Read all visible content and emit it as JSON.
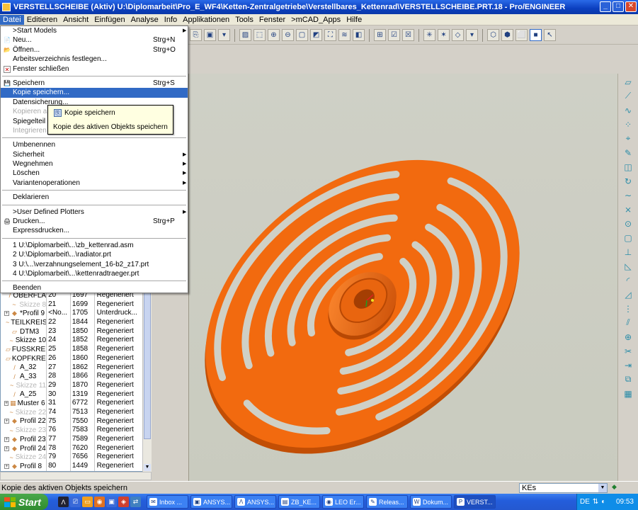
{
  "window": {
    "title": "VERSTELLSCHEIBE (Aktiv) U:\\Diplomarbeit\\Pro_E_WF4\\Ketten-Zentralgetriebe\\Verstellbares_Kettenrad\\VERSTELLSCHEIBE.PRT.18 - Pro/ENGINEER",
    "buttons": {
      "minimize": "_",
      "maximize": "□",
      "close": "✕"
    }
  },
  "menubar": [
    "Datei",
    "Editieren",
    "Ansicht",
    "Einfügen",
    "Analyse",
    "Info",
    "Applikationen",
    "Tools",
    "Fenster",
    ">mCAD_Apps",
    "Hilfe"
  ],
  "file_menu": {
    "start_models": ">Start Models",
    "neu": "Neu...",
    "neu_sc": "Strg+N",
    "oeffnen": "Öffnen...",
    "oeffnen_sc": "Strg+O",
    "arbeitsverzeichnis": "Arbeitsverzeichnis festlegen...",
    "fenster_schliessen": "Fenster schließen",
    "speichern": "Speichern",
    "speichern_sc": "Strg+S",
    "kopie_speichern": "Kopie speichern...",
    "datensicherung": "Datensicherung...",
    "kopieren_als": "Kopieren a",
    "spiegelteil": "Spiegelteil",
    "integrieren": "Integrieren",
    "umbenennen": "Umbenennen",
    "sicherheit": "Sicherheit",
    "wegnehmen": "Wegnehmen",
    "loeschen": "Löschen",
    "variantenoperationen": "Variantenoperationen",
    "deklarieren": "Deklarieren",
    "user_plotters": ">User Defined Plotters",
    "drucken": "Drucken...",
    "drucken_sc": "Strg+P",
    "expressdrucken": "Expressdrucken...",
    "recent1": "1 U:\\Diplomarbeit\\...\\zb_kettenrad.asm",
    "recent2": "2 U:\\Diplomarbeit\\...\\radiator.prt",
    "recent3": "3 U:\\...\\verzahnungselement_16-b2_z17.prt",
    "recent4": "4 U:\\Diplomarbeit\\...\\kettenradtraeger.prt",
    "beenden": "Beenden"
  },
  "tooltip": {
    "title": "Kopie speichern",
    "description": "Kopie des aktiven Objekts speichern"
  },
  "tree_rows": [
    {
      "name": "OBERFLÄ",
      "num": "20",
      "id": "1697",
      "status": "Regeneriert",
      "icon": "/",
      "expand": false,
      "dim": false
    },
    {
      "name": "Skizze 8",
      "num": "21",
      "id": "1699",
      "status": "Regeneriert",
      "icon": "~",
      "expand": false,
      "dim": true
    },
    {
      "name": "*Profil 9",
      "num": "<No...",
      "id": "1705",
      "status": "Unterdruck...",
      "icon": "◆",
      "expand": true,
      "dim": false
    },
    {
      "name": "TEILKREIS",
      "num": "22",
      "id": "1844",
      "status": "Regeneriert",
      "icon": "~",
      "expand": false,
      "dim": false
    },
    {
      "name": "DTM3",
      "num": "23",
      "id": "1850",
      "status": "Regeneriert",
      "icon": "▱",
      "expand": false,
      "dim": false
    },
    {
      "name": "Skizze 10",
      "num": "24",
      "id": "1852",
      "status": "Regeneriert",
      "icon": "~",
      "expand": false,
      "dim": false
    },
    {
      "name": "FUSSKREIS",
      "num": "25",
      "id": "1858",
      "status": "Regeneriert",
      "icon": "▱",
      "expand": false,
      "dim": false
    },
    {
      "name": "KOPFKREIS",
      "num": "26",
      "id": "1860",
      "status": "Regeneriert",
      "icon": "▱",
      "expand": false,
      "dim": false
    },
    {
      "name": "A_32",
      "num": "27",
      "id": "1862",
      "status": "Regeneriert",
      "icon": "/",
      "expand": false,
      "dim": false
    },
    {
      "name": "A_33",
      "num": "28",
      "id": "1866",
      "status": "Regeneriert",
      "icon": "/",
      "expand": false,
      "dim": false
    },
    {
      "name": "Skizze 11",
      "num": "29",
      "id": "1870",
      "status": "Regeneriert",
      "icon": "~",
      "expand": false,
      "dim": true
    },
    {
      "name": "A_25",
      "num": "30",
      "id": "1319",
      "status": "Regeneriert",
      "icon": "/",
      "expand": false,
      "dim": false
    },
    {
      "name": "Muster 6 v",
      "num": "31",
      "id": "6772",
      "status": "Regeneriert",
      "icon": "▦",
      "expand": true,
      "dim": false
    },
    {
      "name": "Skizze 22",
      "num": "74",
      "id": "7513",
      "status": "Regeneriert",
      "icon": "~",
      "expand": false,
      "dim": true
    },
    {
      "name": "Profil 22",
      "num": "75",
      "id": "7550",
      "status": "Regeneriert",
      "icon": "◆",
      "expand": true,
      "dim": false
    },
    {
      "name": "Skizze 23",
      "num": "76",
      "id": "7583",
      "status": "Regeneriert",
      "icon": "~",
      "expand": false,
      "dim": true
    },
    {
      "name": "Profil 23",
      "num": "77",
      "id": "7589",
      "status": "Regeneriert",
      "icon": "◆",
      "expand": true,
      "dim": false
    },
    {
      "name": "Profil 24",
      "num": "78",
      "id": "7620",
      "status": "Regeneriert",
      "icon": "◆",
      "expand": true,
      "dim": false
    },
    {
      "name": "Skizze 24",
      "num": "79",
      "id": "7656",
      "status": "Regeneriert",
      "icon": "~",
      "expand": false,
      "dim": true
    },
    {
      "name": "Profil 8",
      "num": "80",
      "id": "1449",
      "status": "Regeneriert",
      "icon": "◆",
      "expand": true,
      "dim": false
    }
  ],
  "statusbar": {
    "message": "Kopie des aktiven Objekts speichern",
    "filter_value": "KEs"
  },
  "taskbar": {
    "start": "Start",
    "tasks": [
      {
        "label": "Inbox ...",
        "icon": "✉"
      },
      {
        "label": "ANSYS...",
        "icon": "▣"
      },
      {
        "label": "ANSYS...",
        "icon": "Λ"
      },
      {
        "label": "ZB_KE...",
        "icon": "▤"
      },
      {
        "label": "LEO Er...",
        "icon": "◉"
      },
      {
        "label": "Releas...",
        "icon": "✎"
      },
      {
        "label": "Dokum...",
        "icon": "W"
      },
      {
        "label": "VERST...",
        "icon": "P"
      }
    ],
    "language": "DE",
    "clock": "09:53"
  },
  "colors": {
    "part_orange": "#f26a0f",
    "part_dark": "#c24e05",
    "viewport_bg": "#cfd0c6",
    "menu_highlight": "#316ac5",
    "titlebar_blue": "#0b3fbf"
  }
}
